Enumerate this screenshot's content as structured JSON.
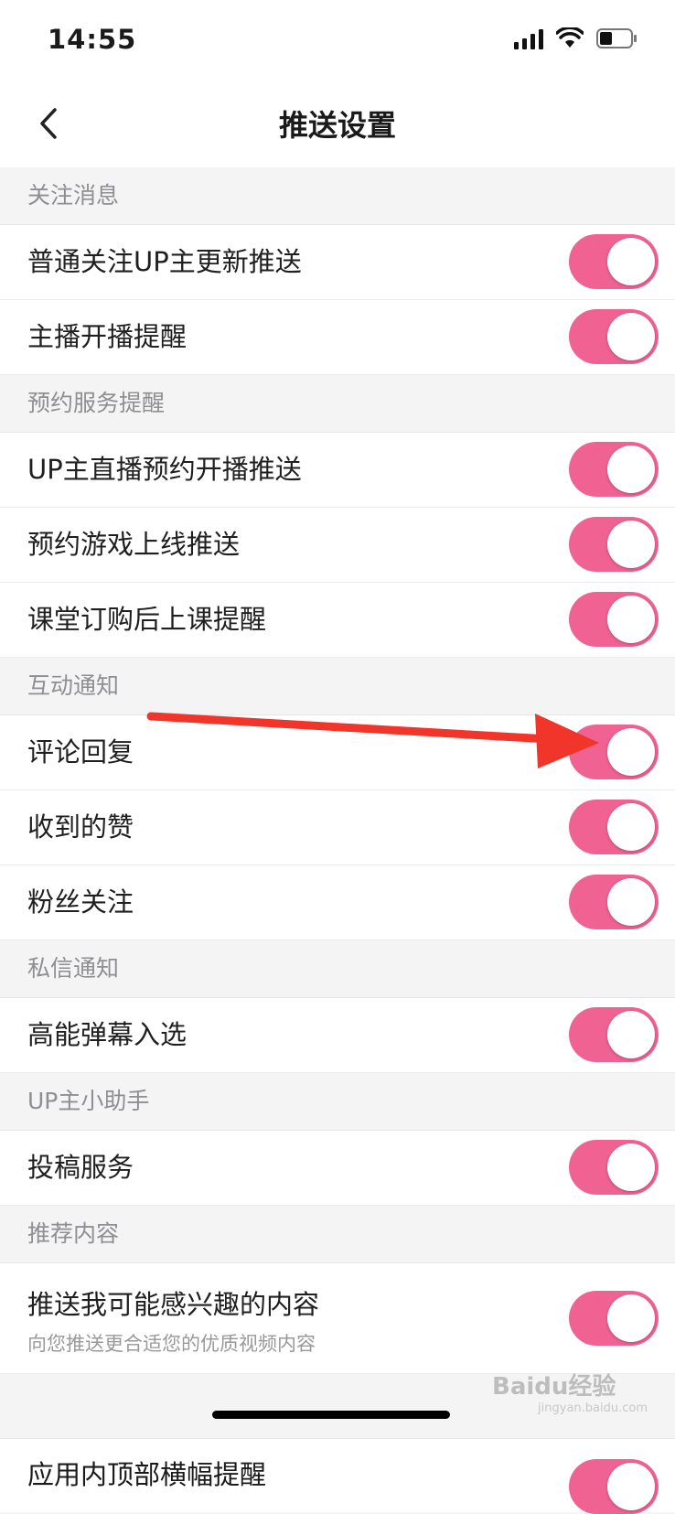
{
  "status": {
    "time": "14:55"
  },
  "nav": {
    "title": "推送设置"
  },
  "sections": [
    {
      "header": "关注消息",
      "items": [
        {
          "label": "普通关注UP主更新推送",
          "on": true
        },
        {
          "label": "主播开播提醒",
          "on": true
        }
      ]
    },
    {
      "header": "预约服务提醒",
      "items": [
        {
          "label": "UP主直播预约开播推送",
          "on": true
        },
        {
          "label": "预约游戏上线推送",
          "on": true
        },
        {
          "label": "课堂订购后上课提醒",
          "on": true
        }
      ]
    },
    {
      "header": "互动通知",
      "items": [
        {
          "label": "评论回复",
          "on": true
        },
        {
          "label": "收到的赞",
          "on": true
        },
        {
          "label": "粉丝关注",
          "on": true
        }
      ]
    },
    {
      "header": "私信通知",
      "items": [
        {
          "label": "高能弹幕入选",
          "on": true
        }
      ]
    },
    {
      "header": "UP主小助手",
      "items": [
        {
          "label": "投稿服务",
          "on": true
        }
      ]
    },
    {
      "header": "推荐内容",
      "items": [
        {
          "label": "推送我可能感兴趣的内容",
          "sub": "向您推送更合适您的优质视频内容",
          "on": true
        }
      ]
    }
  ],
  "partial_item": {
    "label": "应用内顶部横幅提醒",
    "on": true
  },
  "watermark": {
    "brand": "Baidu经验",
    "url": "jingyan.baidu.com"
  },
  "colors": {
    "toggle_on": "#f06292",
    "arrow": "#f2352a"
  },
  "icons": [
    "back-arrow-icon",
    "signal-icon",
    "wifi-icon",
    "battery-icon"
  ]
}
